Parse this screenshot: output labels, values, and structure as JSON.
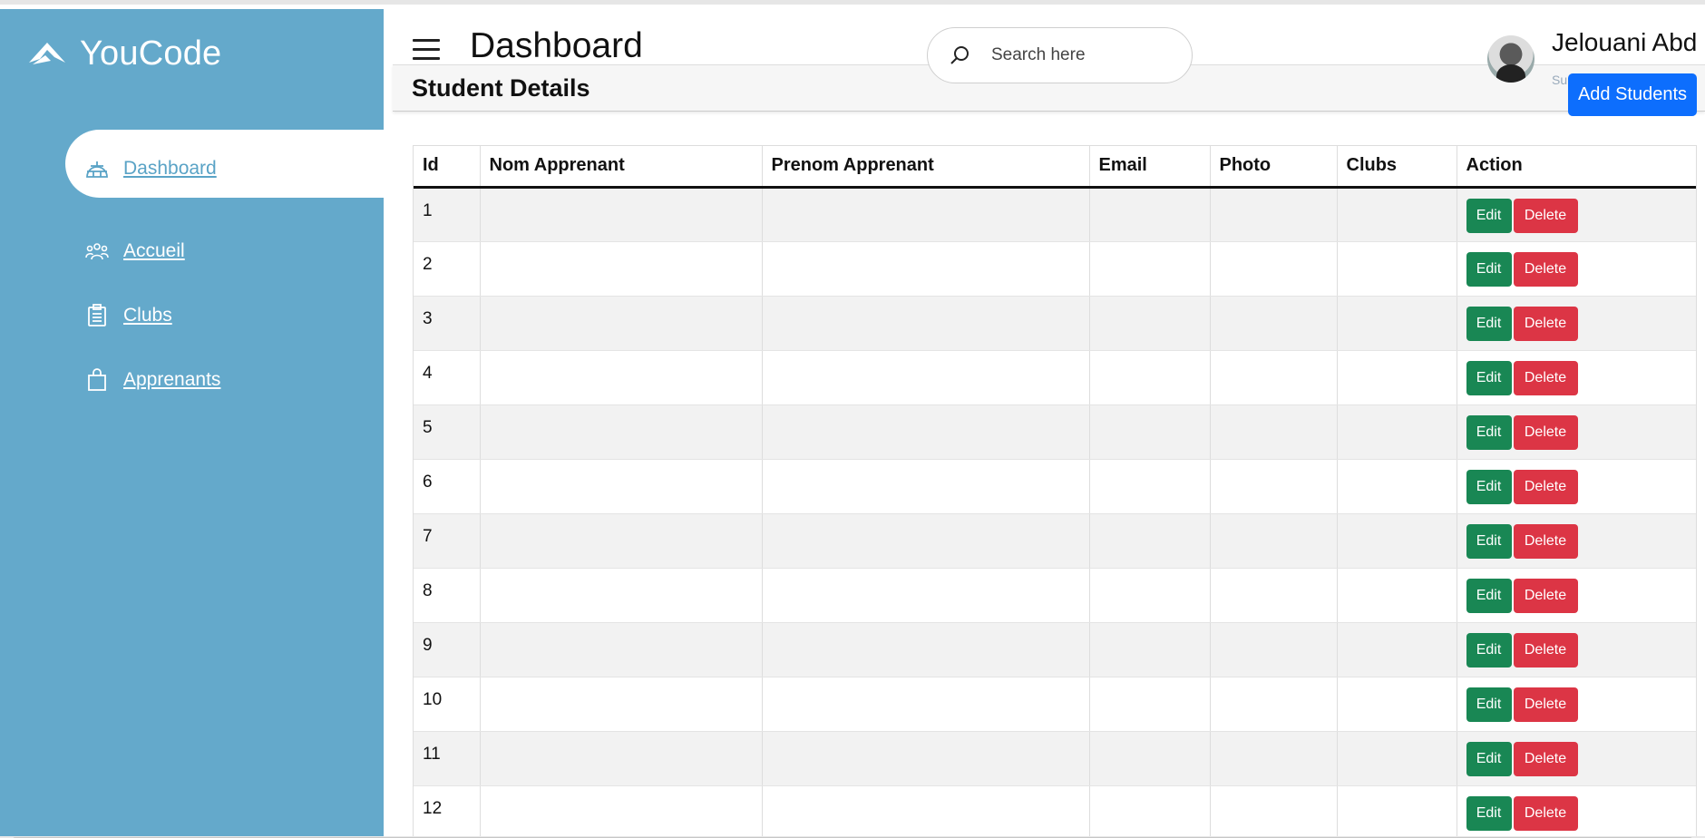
{
  "app": {
    "brand_name": "YouCode",
    "page_title": "Dashboard",
    "accent": "#64a9cb"
  },
  "sidebar": {
    "items": [
      {
        "label": " Dashboard",
        "icon": "igloo-icon",
        "active": true
      },
      {
        "label": " Accueil",
        "icon": "users-icon",
        "active": false
      },
      {
        "label": " Clubs",
        "icon": "clipboard-icon",
        "active": false
      },
      {
        "label": " Apprenants",
        "icon": "shopping-bag-icon",
        "active": false
      }
    ]
  },
  "search": {
    "placeholder": "Search here"
  },
  "user": {
    "name": "Jelouani Abd",
    "role": "Super admin"
  },
  "content": {
    "section_title": "Student Details",
    "add_button_label": "Add Students"
  },
  "table": {
    "columns": [
      "Id",
      "Nom Apprenant",
      "Prenom Apprenant",
      "Email",
      "Photo",
      "Clubs",
      "Action"
    ],
    "rows": [
      {
        "id": "1",
        "nom": "",
        "prenom": "",
        "email": "",
        "photo": "",
        "clubs": ""
      },
      {
        "id": "2",
        "nom": "",
        "prenom": "",
        "email": "",
        "photo": "",
        "clubs": ""
      },
      {
        "id": "3",
        "nom": "",
        "prenom": "",
        "email": "",
        "photo": "",
        "clubs": ""
      },
      {
        "id": "4",
        "nom": "",
        "prenom": "",
        "email": "",
        "photo": "",
        "clubs": ""
      },
      {
        "id": "5",
        "nom": "",
        "prenom": "",
        "email": "",
        "photo": "",
        "clubs": ""
      },
      {
        "id": "6",
        "nom": "",
        "prenom": "",
        "email": "",
        "photo": "",
        "clubs": ""
      },
      {
        "id": "7",
        "nom": "",
        "prenom": "",
        "email": "",
        "photo": "",
        "clubs": ""
      },
      {
        "id": "8",
        "nom": "",
        "prenom": "",
        "email": "",
        "photo": "",
        "clubs": ""
      },
      {
        "id": "9",
        "nom": "",
        "prenom": "",
        "email": "",
        "photo": "",
        "clubs": ""
      },
      {
        "id": "10",
        "nom": "",
        "prenom": "",
        "email": "",
        "photo": "",
        "clubs": ""
      },
      {
        "id": "11",
        "nom": "",
        "prenom": "",
        "email": "",
        "photo": "",
        "clubs": ""
      },
      {
        "id": "12",
        "nom": "",
        "prenom": "",
        "email": "",
        "photo": "",
        "clubs": ""
      }
    ],
    "edit_label": "Edit",
    "delete_label": "Delete",
    "edit_color": "#198754",
    "delete_color": "#dc3545"
  }
}
